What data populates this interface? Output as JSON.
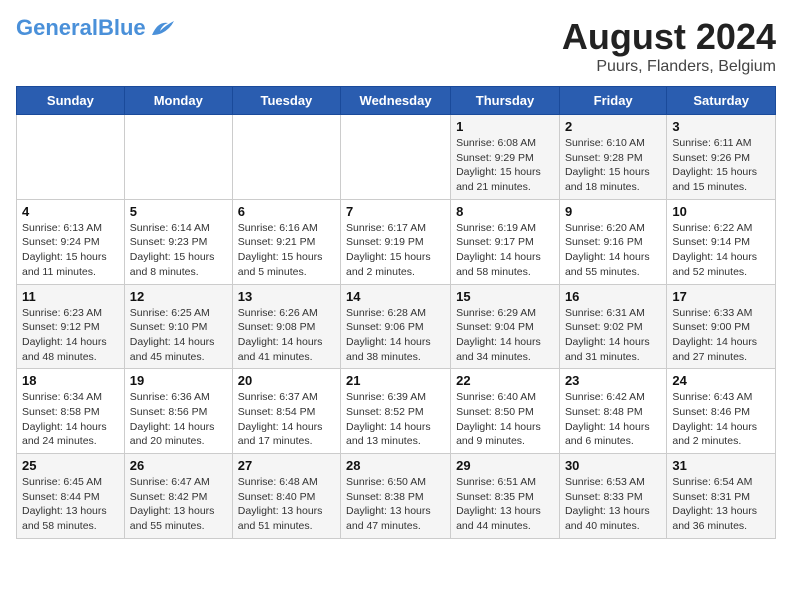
{
  "header": {
    "logo_line1": "General",
    "logo_line2": "Blue",
    "title": "August 2024",
    "subtitle": "Puurs, Flanders, Belgium"
  },
  "weekdays": [
    "Sunday",
    "Monday",
    "Tuesday",
    "Wednesday",
    "Thursday",
    "Friday",
    "Saturday"
  ],
  "weeks": [
    [
      {
        "day": "",
        "info": ""
      },
      {
        "day": "",
        "info": ""
      },
      {
        "day": "",
        "info": ""
      },
      {
        "day": "",
        "info": ""
      },
      {
        "day": "1",
        "info": "Sunrise: 6:08 AM\nSunset: 9:29 PM\nDaylight: 15 hours and 21 minutes."
      },
      {
        "day": "2",
        "info": "Sunrise: 6:10 AM\nSunset: 9:28 PM\nDaylight: 15 hours and 18 minutes."
      },
      {
        "day": "3",
        "info": "Sunrise: 6:11 AM\nSunset: 9:26 PM\nDaylight: 15 hours and 15 minutes."
      }
    ],
    [
      {
        "day": "4",
        "info": "Sunrise: 6:13 AM\nSunset: 9:24 PM\nDaylight: 15 hours and 11 minutes."
      },
      {
        "day": "5",
        "info": "Sunrise: 6:14 AM\nSunset: 9:23 PM\nDaylight: 15 hours and 8 minutes."
      },
      {
        "day": "6",
        "info": "Sunrise: 6:16 AM\nSunset: 9:21 PM\nDaylight: 15 hours and 5 minutes."
      },
      {
        "day": "7",
        "info": "Sunrise: 6:17 AM\nSunset: 9:19 PM\nDaylight: 15 hours and 2 minutes."
      },
      {
        "day": "8",
        "info": "Sunrise: 6:19 AM\nSunset: 9:17 PM\nDaylight: 14 hours and 58 minutes."
      },
      {
        "day": "9",
        "info": "Sunrise: 6:20 AM\nSunset: 9:16 PM\nDaylight: 14 hours and 55 minutes."
      },
      {
        "day": "10",
        "info": "Sunrise: 6:22 AM\nSunset: 9:14 PM\nDaylight: 14 hours and 52 minutes."
      }
    ],
    [
      {
        "day": "11",
        "info": "Sunrise: 6:23 AM\nSunset: 9:12 PM\nDaylight: 14 hours and 48 minutes."
      },
      {
        "day": "12",
        "info": "Sunrise: 6:25 AM\nSunset: 9:10 PM\nDaylight: 14 hours and 45 minutes."
      },
      {
        "day": "13",
        "info": "Sunrise: 6:26 AM\nSunset: 9:08 PM\nDaylight: 14 hours and 41 minutes."
      },
      {
        "day": "14",
        "info": "Sunrise: 6:28 AM\nSunset: 9:06 PM\nDaylight: 14 hours and 38 minutes."
      },
      {
        "day": "15",
        "info": "Sunrise: 6:29 AM\nSunset: 9:04 PM\nDaylight: 14 hours and 34 minutes."
      },
      {
        "day": "16",
        "info": "Sunrise: 6:31 AM\nSunset: 9:02 PM\nDaylight: 14 hours and 31 minutes."
      },
      {
        "day": "17",
        "info": "Sunrise: 6:33 AM\nSunset: 9:00 PM\nDaylight: 14 hours and 27 minutes."
      }
    ],
    [
      {
        "day": "18",
        "info": "Sunrise: 6:34 AM\nSunset: 8:58 PM\nDaylight: 14 hours and 24 minutes."
      },
      {
        "day": "19",
        "info": "Sunrise: 6:36 AM\nSunset: 8:56 PM\nDaylight: 14 hours and 20 minutes."
      },
      {
        "day": "20",
        "info": "Sunrise: 6:37 AM\nSunset: 8:54 PM\nDaylight: 14 hours and 17 minutes."
      },
      {
        "day": "21",
        "info": "Sunrise: 6:39 AM\nSunset: 8:52 PM\nDaylight: 14 hours and 13 minutes."
      },
      {
        "day": "22",
        "info": "Sunrise: 6:40 AM\nSunset: 8:50 PM\nDaylight: 14 hours and 9 minutes."
      },
      {
        "day": "23",
        "info": "Sunrise: 6:42 AM\nSunset: 8:48 PM\nDaylight: 14 hours and 6 minutes."
      },
      {
        "day": "24",
        "info": "Sunrise: 6:43 AM\nSunset: 8:46 PM\nDaylight: 14 hours and 2 minutes."
      }
    ],
    [
      {
        "day": "25",
        "info": "Sunrise: 6:45 AM\nSunset: 8:44 PM\nDaylight: 13 hours and 58 minutes."
      },
      {
        "day": "26",
        "info": "Sunrise: 6:47 AM\nSunset: 8:42 PM\nDaylight: 13 hours and 55 minutes."
      },
      {
        "day": "27",
        "info": "Sunrise: 6:48 AM\nSunset: 8:40 PM\nDaylight: 13 hours and 51 minutes."
      },
      {
        "day": "28",
        "info": "Sunrise: 6:50 AM\nSunset: 8:38 PM\nDaylight: 13 hours and 47 minutes."
      },
      {
        "day": "29",
        "info": "Sunrise: 6:51 AM\nSunset: 8:35 PM\nDaylight: 13 hours and 44 minutes."
      },
      {
        "day": "30",
        "info": "Sunrise: 6:53 AM\nSunset: 8:33 PM\nDaylight: 13 hours and 40 minutes."
      },
      {
        "day": "31",
        "info": "Sunrise: 6:54 AM\nSunset: 8:31 PM\nDaylight: 13 hours and 36 minutes."
      }
    ]
  ]
}
